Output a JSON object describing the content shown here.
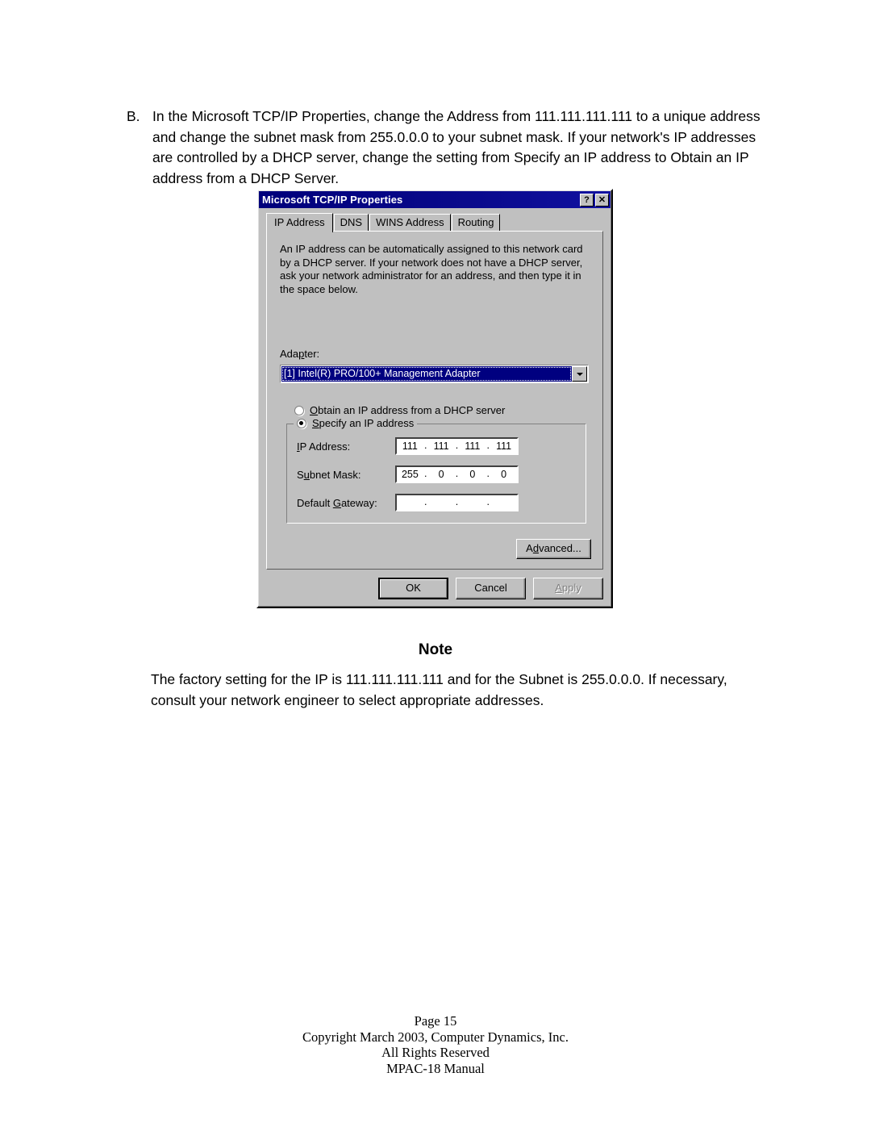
{
  "step": {
    "letter": "B.",
    "text": "In the Microsoft TCP/IP Properties, change the Address from 111.111.111.111 to a unique address and change the subnet mask from 255.0.0.0 to your subnet mask. If your network's IP addresses are controlled by a DHCP server, change the setting from Specify an IP address to Obtain an IP address from a DHCP Server."
  },
  "dialog": {
    "title": "Microsoft TCP/IP Properties",
    "titlebar_buttons": {
      "help": "?",
      "close": "✕"
    },
    "tabs": [
      {
        "label": "IP Address",
        "active": true
      },
      {
        "label": "DNS",
        "active": false
      },
      {
        "label": "WINS Address",
        "active": false
      },
      {
        "label": "Routing",
        "active": false
      }
    ],
    "description": "An IP address can be automatically assigned to this network card by a DHCP server.  If your network does not have a DHCP server, ask your network administrator for an address, and then type it in the space below.",
    "adapter": {
      "label": "Adapter:",
      "selected": "[1] Intel(R) PRO/100+ Management Adapter"
    },
    "radios": {
      "dhcp_label": "Obtain an IP address from a DHCP server",
      "dhcp_checked": false,
      "specify_label": "Specify an IP address",
      "specify_checked": true
    },
    "fields": [
      {
        "label": "IP Address:",
        "octets": [
          "111",
          "111",
          "111",
          "111"
        ]
      },
      {
        "label": "Subnet Mask:",
        "octets": [
          "255",
          "0",
          "0",
          "0"
        ]
      },
      {
        "label": "Default Gateway:",
        "octets": [
          "",
          "",
          "",
          ""
        ]
      }
    ],
    "buttons": {
      "advanced": "Advanced...",
      "ok": "OK",
      "cancel": "Cancel",
      "apply": "Apply",
      "apply_disabled": true
    },
    "colors": {
      "face": "#c0c0c0",
      "titlebar": "#000080",
      "selection": "#000080",
      "selection_text": "#ffffff",
      "disabled_text": "#808080"
    }
  },
  "note": {
    "heading": "Note",
    "body": "The factory setting for the IP is 111.111.111.111 and for the Subnet is 255.0.0.0. If necessary, consult your network engineer to select appropriate addresses."
  },
  "footer": {
    "line1": "Page 15",
    "line2": "Copyright March 2003, Computer Dynamics, Inc.",
    "line3": "All Rights Reserved",
    "line4": "MPAC-18 Manual"
  }
}
